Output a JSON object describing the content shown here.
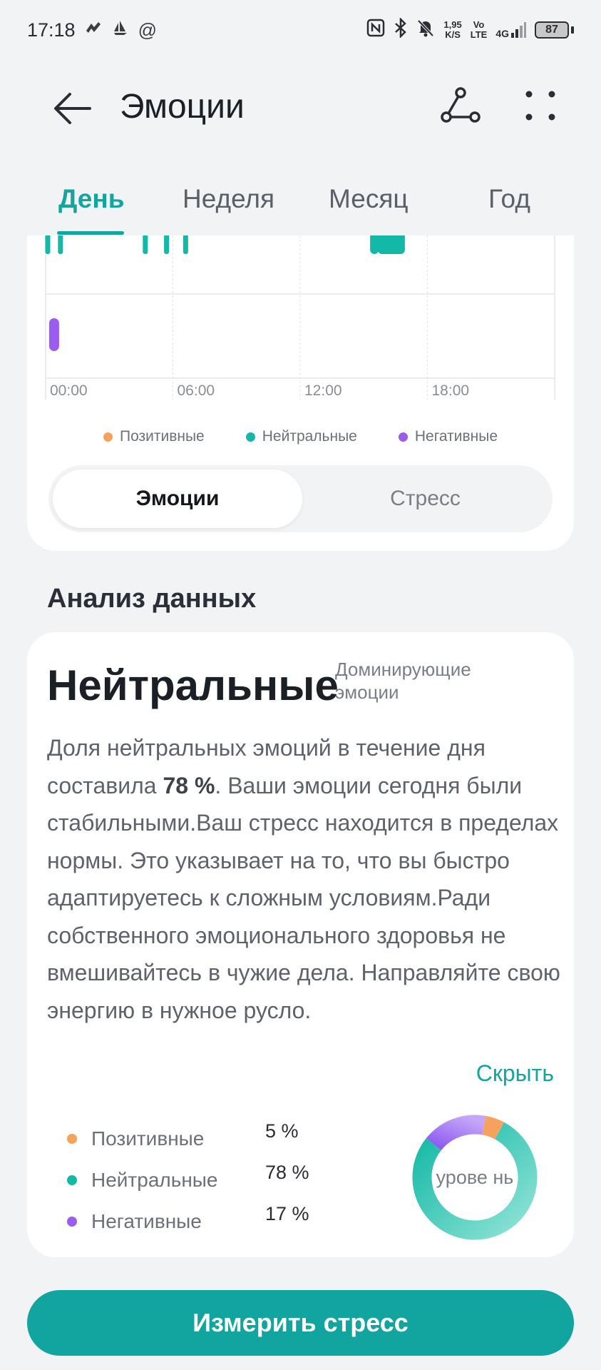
{
  "status_bar": {
    "time": "17:18",
    "speed_value": "1,95",
    "speed_unit": "K/S",
    "volte_top": "Vo",
    "volte_bottom": "LTE",
    "network": "4G",
    "battery": "87"
  },
  "header": {
    "title": "Эмоции"
  },
  "tabs": [
    {
      "label": "День",
      "active": true
    },
    {
      "label": "Неделя",
      "active": false
    },
    {
      "label": "Месяц",
      "active": false
    },
    {
      "label": "Год",
      "active": false
    }
  ],
  "chart": {
    "time_labels": [
      "00:00",
      "06:00",
      "12:00",
      "18:00"
    ],
    "legend": [
      "Позитивные",
      "Нейтральные",
      "Негативные"
    ],
    "colors": {
      "positive": "#f5a25d",
      "neutral": "#14b8a6",
      "negative": "#9b5cf0"
    }
  },
  "chart_data": {
    "type": "bar",
    "x_axis_labels": [
      "00:00",
      "06:00",
      "12:00",
      "18:00"
    ],
    "series": [
      {
        "name": "Нейтральные",
        "hours": [
          0.1,
          0.7,
          4.7,
          5.7,
          6.6,
          15.5,
          16.3
        ]
      },
      {
        "name": "Негативные",
        "hours": [
          0.4
        ]
      }
    ]
  },
  "segmented": {
    "active": "Эмоции",
    "inactive": "Стресс"
  },
  "analysis": {
    "section_title": "Анализ данных",
    "dominant": "Нейтральные",
    "dominant_label": "Доминирующие эмоции",
    "text_pre": "Доля нейтральных эмоций в течение дня составила ",
    "text_bold": "78 %",
    "text_post": ". Ваши эмоции сегодня были стабильными.Ваш стресс находится в пределах нормы. Это указывает на то, что вы быстро адаптируетесь к сложным условиям.Ради собственного эмоционального здоровья не вмешивайтесь в чужие дела. Направляйте свою энергию в нужное русло.",
    "hide": "Скрыть",
    "breakdown": [
      {
        "label": "Позитивные",
        "value": "5 %",
        "percent": 5,
        "color": "#f5a25d"
      },
      {
        "label": "Нейтральные",
        "value": "78 %",
        "percent": 78,
        "color": "#14b8a6"
      },
      {
        "label": "Негативные",
        "value": "17 %",
        "percent": 17,
        "color": "#9b5cf0"
      }
    ],
    "donut_label": "урове нь"
  },
  "measure_button": "Измерить стресс"
}
